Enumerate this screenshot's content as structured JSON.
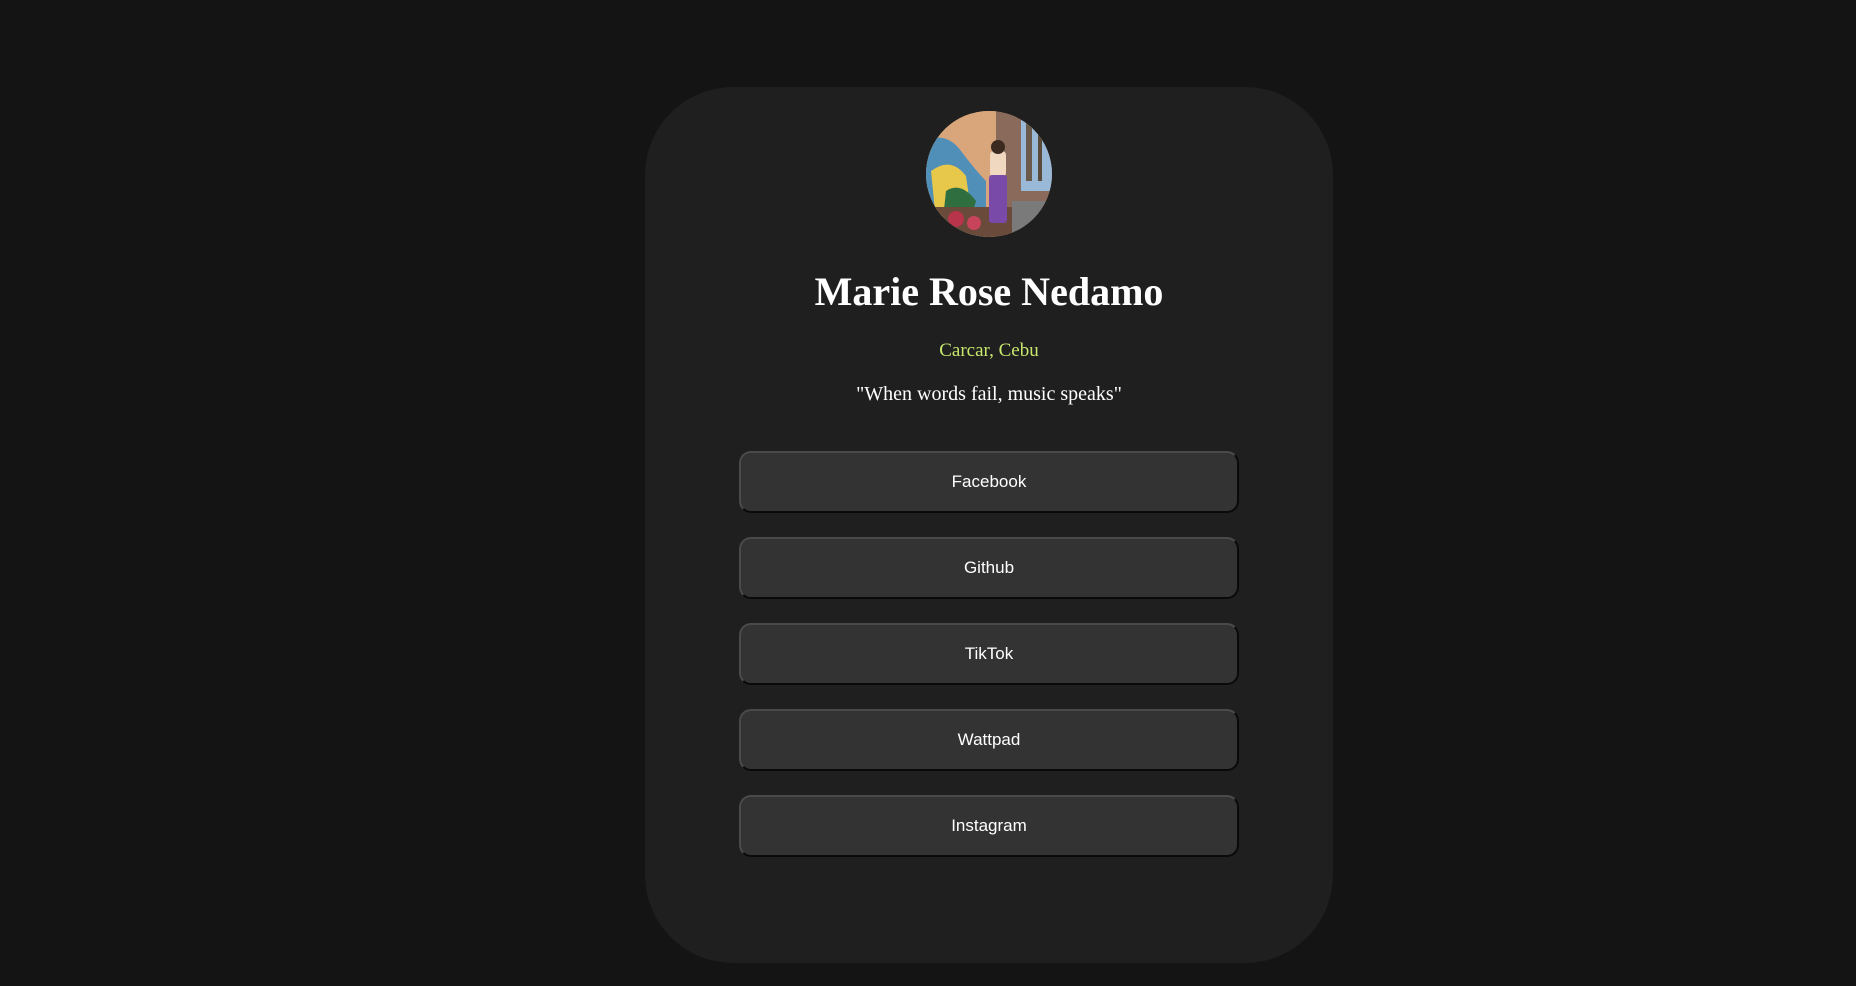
{
  "profile": {
    "name": "Marie Rose Nedamo",
    "location": "Carcar, Cebu",
    "quote": "\"When words fail, music speaks\""
  },
  "links": [
    {
      "label": "Facebook"
    },
    {
      "label": "Github"
    },
    {
      "label": "TikTok"
    },
    {
      "label": "Wattpad"
    },
    {
      "label": "Instagram"
    }
  ],
  "colors": {
    "page_background": "#141414",
    "card_background": "#1f1f1f",
    "button_background": "#333333",
    "location_text": "#c8e86e",
    "text": "#ffffff"
  }
}
